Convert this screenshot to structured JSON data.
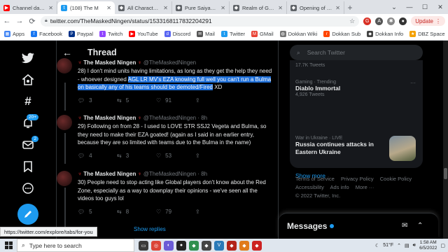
{
  "browser": {
    "tabs": [
      {
        "title": "Channel dashb",
        "color": "#ff0000",
        "glyph": "▶"
      },
      {
        "title": "(108) The M",
        "color": "#1d9bf0",
        "glyph": "t"
      },
      {
        "title": "All Character C",
        "color": "#5f6368",
        "glyph": "◆"
      },
      {
        "title": "Pure Saiyans | D",
        "color": "#5f6368",
        "glyph": "◆"
      },
      {
        "title": "Realm of Gods",
        "color": "#5f6368",
        "glyph": "◆"
      },
      {
        "title": "Opening of a S",
        "color": "#5f6368",
        "glyph": "◆"
      }
    ],
    "new_tab": "+",
    "url": "twitter.com/TheMaskedNingen/status/1533168117832204291",
    "update_label": "Update",
    "bookmarks": [
      {
        "label": "Apps",
        "color": "#4285f4"
      },
      {
        "label": "Facebook",
        "color": "#1877f2"
      },
      {
        "label": "Paypal",
        "color": "#003087"
      },
      {
        "label": "Twitch",
        "color": "#9146ff"
      },
      {
        "label": "YouTube",
        "color": "#ff0000"
      },
      {
        "label": "Discord",
        "color": "#5865f2"
      },
      {
        "label": "Mail",
        "color": "#555555"
      },
      {
        "label": "Twitter",
        "color": "#1d9bf0"
      },
      {
        "label": "GMail",
        "color": "#ea4335"
      },
      {
        "label": "Dokkan Wiki",
        "color": "#777777"
      },
      {
        "label": "Dokkan Sub",
        "color": "#ff4500"
      },
      {
        "label": "Dokkan Info",
        "color": "#444444"
      },
      {
        "label": "DBZ Space",
        "color": "#f4a100"
      }
    ]
  },
  "twitter": {
    "header_title": "Thread",
    "nav_badge": "20+",
    "msg_badge": "2",
    "tweets": [
      {
        "name": "The Masked Ningen",
        "handle": "@TheMaskedNingen",
        "time": "",
        "text_before": "28) I don't mind units having limitations, as long as they get the help they need - whoever designed ",
        "text_highlight": "AGL LR MV's EZA knowing full well you can't run a Bulma on basically any of his teams should be demoted/Fired",
        "text_after": " XD",
        "replies": "3",
        "retweets": "5",
        "likes": "91"
      },
      {
        "name": "The Masked Ningen",
        "handle": "@TheMaskedNingen",
        "time": "· 8h",
        "text": "29) Following on from 28 - I used to LOVE STR SSJ2 Vegeta and Bulma, so they need to make their EZA goated! (again as I said in an earlier entry, because they are so limited with teams due to the Bulma in the name)",
        "replies": "4",
        "retweets": "3",
        "likes": "53"
      },
      {
        "name": "The Masked Ningen",
        "handle": "@TheMaskedNingen",
        "time": "· 8h",
        "text": "30) People need to stop acting like Global players don't know about the Red Zone, especially as a way to downplay their opinions - we've seen all the videos too guys lol",
        "replies": "5",
        "retweets": "8",
        "likes": "79"
      }
    ],
    "show_replies": "Show replies",
    "search_placeholder": "Search Twitter",
    "trends": [
      {
        "category": "",
        "name": "",
        "count": "17.7K Tweets"
      },
      {
        "category": "Gaming · Trending",
        "name": "Diablo Immortal",
        "count": "4,926 Tweets"
      },
      {
        "category": "War in Ukraine · LIVE",
        "name": "Russia continues attacks in Eastern Ukraine",
        "count": ""
      }
    ],
    "show_more": "Show more",
    "footer_links": [
      "Terms of Service",
      "Privacy Policy",
      "Cookie Policy",
      "Accessibility",
      "Ads info",
      "More ···"
    ],
    "copyright": "© 2022 Twitter, Inc.",
    "messages_title": "Messages"
  },
  "status_url": "https://twitter.com/explore/tabs/for-you",
  "taskbar": {
    "search_placeholder": "Type here to search",
    "weather": "51°F",
    "time": "1:58 AM",
    "date": "6/5/2022"
  }
}
